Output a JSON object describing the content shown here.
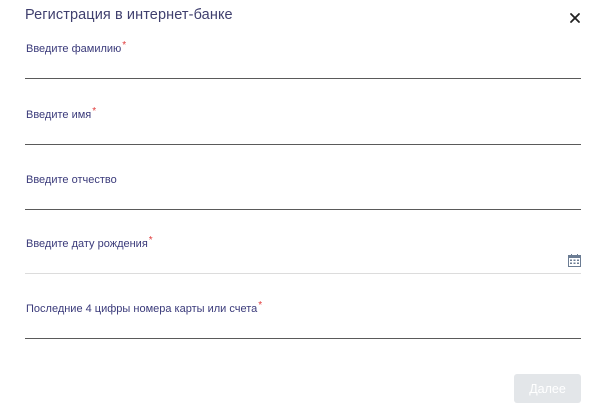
{
  "dialog": {
    "title": "Регистрация в интернет-банке"
  },
  "fields": [
    {
      "label": "Введите фамилию",
      "required": "*",
      "value": ""
    },
    {
      "label": "Введите имя",
      "required": "*",
      "value": ""
    },
    {
      "label": "Введите отчество",
      "value": ""
    },
    {
      "label": "Введите дату рождения",
      "required": "*",
      "value": ""
    },
    {
      "label": "Последние 4 цифры номера карты или счета",
      "required": "*",
      "value": ""
    }
  ],
  "icons": {
    "close": "close-icon",
    "calendar": "calendar-icon"
  },
  "actions": {
    "next_label": "Далее",
    "next_enabled": false
  },
  "colors": {
    "title": "#3f3f6e",
    "label": "#3a3a7a",
    "required": "#e03a3a",
    "button_disabled": "#e3e6e9"
  }
}
